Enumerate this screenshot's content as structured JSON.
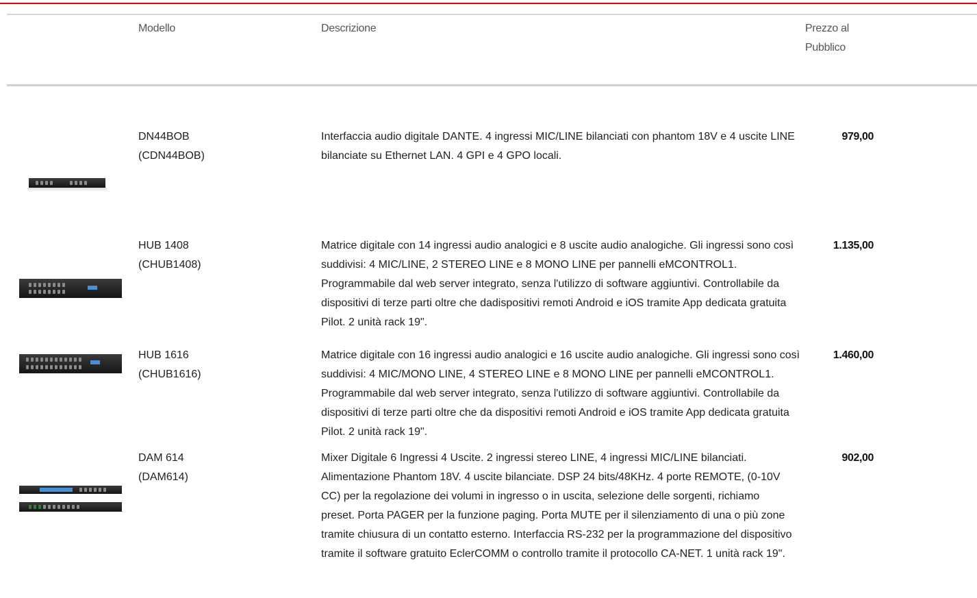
{
  "header": {
    "model": "Modello",
    "description": "Descrizione",
    "price_line1": "Prezzo al",
    "price_line2": "Pubblico"
  },
  "colors": {
    "accent_red": "#e30613",
    "separator": "#d0d0d0"
  },
  "products": [
    {
      "model": "DN44BOB",
      "code": "(CDN44BOB)",
      "description": "Interfaccia audio digitale DANTE. 4 ingressi MIC/LINE bilanciati con phantom 18V e 4 uscite LINE bilanciate su Ethernet LAN. 4 GPI e 4 GPO locali.",
      "price": "979,00"
    },
    {
      "model": "HUB 1408",
      "code": "(CHUB1408)",
      "description": "Matrice digitale con 14 ingressi audio analogici e 8 uscite audio analogiche. Gli ingressi sono così suddivisi: 4 MIC/LINE, 2 STEREO LINE e 8 MONO LINE per pannelli eMCONTROL1. Programmabile dal web server integrato, senza l'utilizzo di software aggiuntivi. Controllabile da dispositivi di terze parti oltre che dadispositivi remoti Android e iOS tramite App dedicata gratuita Pilot. 2 unità rack 19\".",
      "price": "1.135,00"
    },
    {
      "model": "HUB 1616",
      "code": "(CHUB1616)",
      "description": "Matrice digitale con 16 ingressi audio analogici e 16 uscite audio analogiche. Gli ingressi sono così suddivisi: 4 MIC/MONO LINE, 4 STEREO LINE e 8 MONO LINE per pannelli eMCONTROL1. Programmabile dal web server integrato, senza l'utilizzo di software aggiuntivi. Controllabile da dispositivi di terze parti oltre che da dispositivi remoti Android e iOS tramite App dedicata gratuita Pilot. 2 unità rack 19\".",
      "price": "1.460,00"
    },
    {
      "model": "DAM 614",
      "code": "(DAM614)",
      "description": "Mixer Digitale 6 Ingressi 4 Uscite. 2 ingressi stereo LINE, 4 ingressi MIC/LINE bilanciati. Alimentazione Phantom 18V. 4 uscite bilanciate. DSP 24 bits/48KHz. 4 porte REMOTE, (0-10V CC) per la regolazione dei volumi in ingresso o in uscita, selezione delle sorgenti, richiamo preset. Porta PAGER per la funzione paging. Porta MUTE per il silenziamento di una o più zone tramite chiusura di un contatto esterno. Interfaccia RS-232 per la programmazione del dispositivo tramite il software gratuito EclerCOMM o controllo tramite il protocollo CA-NET. 1 unità rack 19\".",
      "price": "902,00"
    }
  ]
}
